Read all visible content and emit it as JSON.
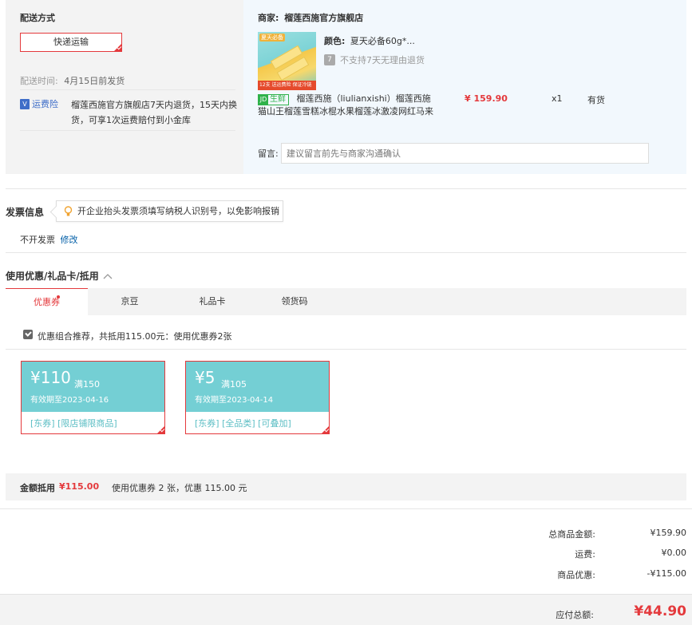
{
  "shipping": {
    "title": "配送方式",
    "method": "快递运输",
    "time_label": "配送时间:",
    "time_value": "4月15日前发货",
    "insurance_icon_text": "运费险",
    "insurance_text_1": "榴莲西施官方旗舰店7天内退货，15天内换",
    "insurance_text_2": "货，可享1次运费赔付到小金库"
  },
  "merchant": {
    "label": "商家:",
    "name": "榴莲西施官方旗舰店",
    "image_top_tag": "夏天必备",
    "image_bottom_tag": "12支 送运费险 保证冷链",
    "color_label": "颜色:",
    "color_value": "夏天必备60g*...",
    "no_return_icon": "7",
    "no_return_text": "不支持7天无理由退货",
    "fresh_badge": "生鲜",
    "fresh_icon": "JD",
    "product_name_1": "榴莲西施（liulianxishi）榴莲西施",
    "product_name_2": "猫山王榴莲雪糕冰棍水果榴莲冰激凌网红马来",
    "price": "¥ 159.90",
    "quantity": "x1",
    "stock": "有货",
    "message_label": "留言:",
    "message_placeholder": "建议留言前先与商家沟通确认"
  },
  "invoice": {
    "title": "发票信息",
    "tooltip": "开企业抬头发票须填写纳税人识别号，以免影响报销",
    "status": "不开发票",
    "edit_link": "修改"
  },
  "discount": {
    "title": "使用优惠/礼品卡/抵用",
    "tabs": [
      {
        "label": "优惠券"
      },
      {
        "label": "京豆"
      },
      {
        "label": "礼品卡"
      },
      {
        "label": "领货码"
      }
    ],
    "recommend_text": "优惠组合推荐，共抵用115.00元：使用优惠券2张",
    "coupons": [
      {
        "amount": "¥110",
        "condition": "满150",
        "expiry": "有效期至2023-04-16",
        "tags": "[东券]   [限店铺限商品]"
      },
      {
        "amount": "¥5",
        "condition": "满105",
        "expiry": "有效期至2023-04-14",
        "tags": "[东券]   [全品类]   [可叠加]"
      }
    ],
    "summary_label": "金额抵用",
    "summary_amount": "¥115.00",
    "summary_text": "使用优惠券 2 张，优惠 115.00 元"
  },
  "totals": {
    "goods_label": "总商品金额:",
    "goods_value": "¥159.90",
    "shipping_label": "运费:",
    "shipping_value": "¥0.00",
    "discount_label": "商品优惠:",
    "discount_value": "-¥115.00",
    "payable_label": "应付总额:",
    "payable_value": "¥44.90"
  },
  "colors": {
    "accent_red": "#e4393c",
    "coupon_teal": "#74cfd4",
    "panel_gray": "#f3f3f3",
    "panel_blue": "#f2f8fd"
  }
}
